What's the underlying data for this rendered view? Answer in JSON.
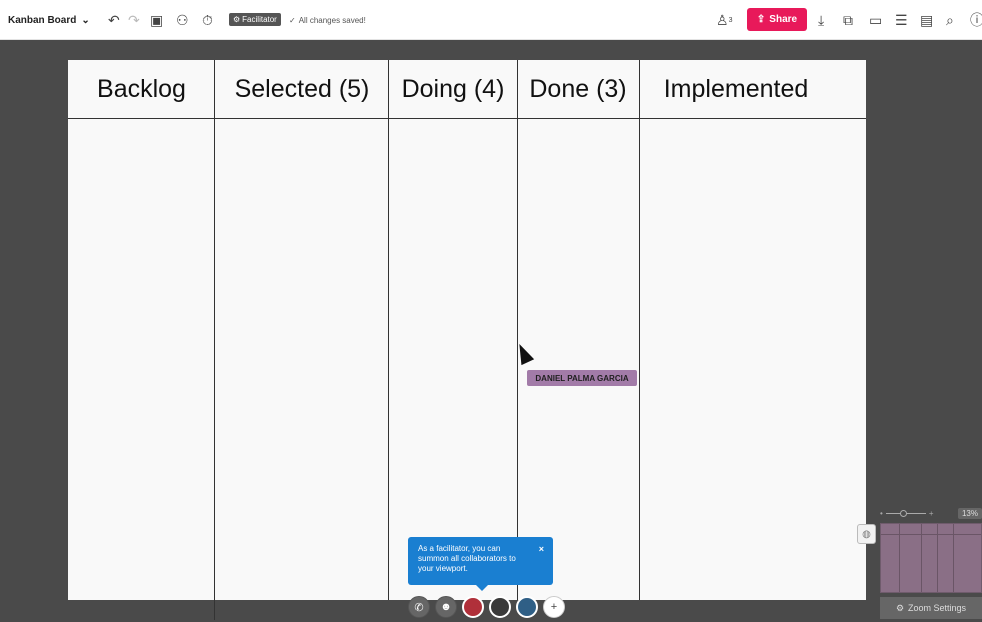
{
  "toolbar": {
    "board_title": "Kanban Board",
    "facilitator_badge": "Facilitator",
    "saved_status": "All changes saved!",
    "collaborator_count": "3",
    "share_label": "Share"
  },
  "board": {
    "columns": [
      {
        "title": "Backlog"
      },
      {
        "title": "Selected (5)"
      },
      {
        "title": "Doing (4)"
      },
      {
        "title": "Done (3)"
      },
      {
        "title": "Implemented"
      }
    ],
    "cursor_label": "DANIEL PALMA GARCIA"
  },
  "tooltip": {
    "text": "As a facilitator, you can summon all collaborators to your viewport.",
    "close": "×"
  },
  "zoom": {
    "percent": "13%",
    "settings_label": "Zoom Settings"
  },
  "colors": {
    "share_button": "#e8195a",
    "tooltip": "#1a7fd1",
    "cursor_tag": "#a27ba8"
  }
}
